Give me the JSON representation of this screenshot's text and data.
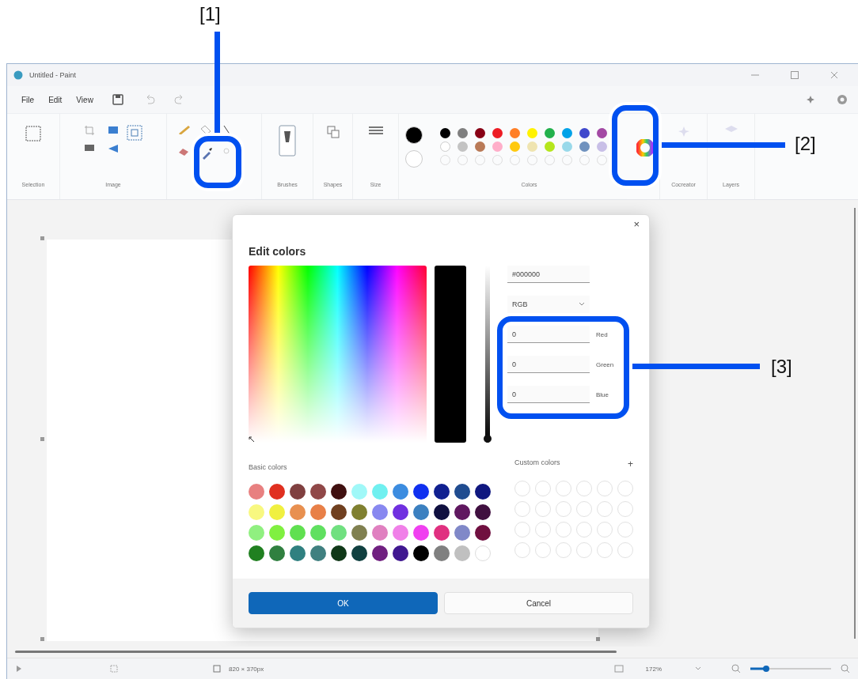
{
  "callouts": [
    {
      "label": "[1]"
    },
    {
      "label": "[2]"
    },
    {
      "label": "[3]"
    }
  ],
  "window": {
    "title": "Untitled - Paint"
  },
  "menu": [
    "File",
    "Edit",
    "View"
  ],
  "ribbon_groups": [
    {
      "kind": "selection",
      "label": "Selection"
    },
    {
      "kind": "image",
      "label": "Image"
    },
    {
      "kind": "tools"
    },
    {
      "kind": "brushes",
      "label": "Brushes"
    },
    {
      "kind": "shapes",
      "label": "Shapes"
    },
    {
      "kind": "size",
      "label": "Size"
    },
    {
      "kind": "colors",
      "label": "Colors",
      "current": [
        {
          "color": "#000000"
        },
        {
          "color": "#ffffff"
        }
      ],
      "palette": [
        {
          "color": "#000000"
        },
        {
          "color": "#7f7f7f"
        },
        {
          "color": "#880015"
        },
        {
          "color": "#ed1c24"
        },
        {
          "color": "#ff7f27"
        },
        {
          "color": "#fff200"
        },
        {
          "color": "#22b14c"
        },
        {
          "color": "#00a2e8"
        },
        {
          "color": "#3f48cc"
        },
        {
          "color": "#a349a4"
        },
        {
          "color": "#ffffff"
        },
        {
          "color": "#c3c3c3"
        },
        {
          "color": "#b97a57"
        },
        {
          "color": "#ffaec9"
        },
        {
          "color": "#ffc90e"
        },
        {
          "color": "#efe4b0"
        },
        {
          "color": "#b5e61d"
        },
        {
          "color": "#99d9ea"
        },
        {
          "color": "#7092be"
        },
        {
          "color": "#c8bfe7"
        }
      ]
    },
    {
      "kind": "cocreator",
      "label": "Cocreator"
    },
    {
      "kind": "layers",
      "label": "Layers"
    }
  ],
  "dialog": {
    "title": "Edit colors",
    "close": "×",
    "hex": "#000000",
    "mode": "RGB",
    "channels": [
      {
        "label": "Red",
        "value": "0"
      },
      {
        "label": "Green",
        "value": "0"
      },
      {
        "label": "Blue",
        "value": "0"
      }
    ],
    "brightness": {
      "level": 0
    },
    "basic_colors_label": "Basic colors",
    "basic_colors": [
      {
        "color": "#e88080"
      },
      {
        "color": "#e03020"
      },
      {
        "color": "#804040"
      },
      {
        "color": "#904848"
      },
      {
        "color": "#401010"
      },
      {
        "color": "#a0f8f8"
      },
      {
        "color": "#70f0f0"
      },
      {
        "color": "#3c8ce0"
      },
      {
        "color": "#1030f0"
      },
      {
        "color": "#102090"
      },
      {
        "color": "#204c90"
      },
      {
        "color": "#101880"
      },
      {
        "color": "#f8f880"
      },
      {
        "color": "#f0f040"
      },
      {
        "color": "#e89050"
      },
      {
        "color": "#e88048"
      },
      {
        "color": "#704020"
      },
      {
        "color": "#808030"
      },
      {
        "color": "#8888f0"
      },
      {
        "color": "#7030e0"
      },
      {
        "color": "#3c80c0"
      },
      {
        "color": "#101040"
      },
      {
        "color": "#601860"
      },
      {
        "color": "#401040"
      },
      {
        "color": "#90f080"
      },
      {
        "color": "#80f040"
      },
      {
        "color": "#60e050"
      },
      {
        "color": "#60e060"
      },
      {
        "color": "#70e080"
      },
      {
        "color": "#808050"
      },
      {
        "color": "#e080c0"
      },
      {
        "color": "#f080e8"
      },
      {
        "color": "#f040f0"
      },
      {
        "color": "#e03080"
      },
      {
        "color": "#8088c8"
      },
      {
        "color": "#701040"
      },
      {
        "color": "#208020"
      },
      {
        "color": "#308040"
      },
      {
        "color": "#308080"
      },
      {
        "color": "#408080"
      },
      {
        "color": "#103818"
      },
      {
        "color": "#104040"
      },
      {
        "color": "#702080"
      },
      {
        "color": "#401890"
      },
      {
        "color": "#000000"
      },
      {
        "color": "#808080"
      },
      {
        "color": "#c0c0c0"
      },
      {
        "color": "#ffffff"
      }
    ],
    "custom_colors_label": "Custom colors",
    "add": "+",
    "buttons": [
      {
        "label": "OK",
        "kind": "primary"
      },
      {
        "label": "Cancel",
        "kind": "secondary"
      }
    ]
  },
  "status_bar": {
    "canvas_size": "820 × 370px",
    "zoom": "172%",
    "zoom_slider": {
      "level": 0.2
    }
  }
}
